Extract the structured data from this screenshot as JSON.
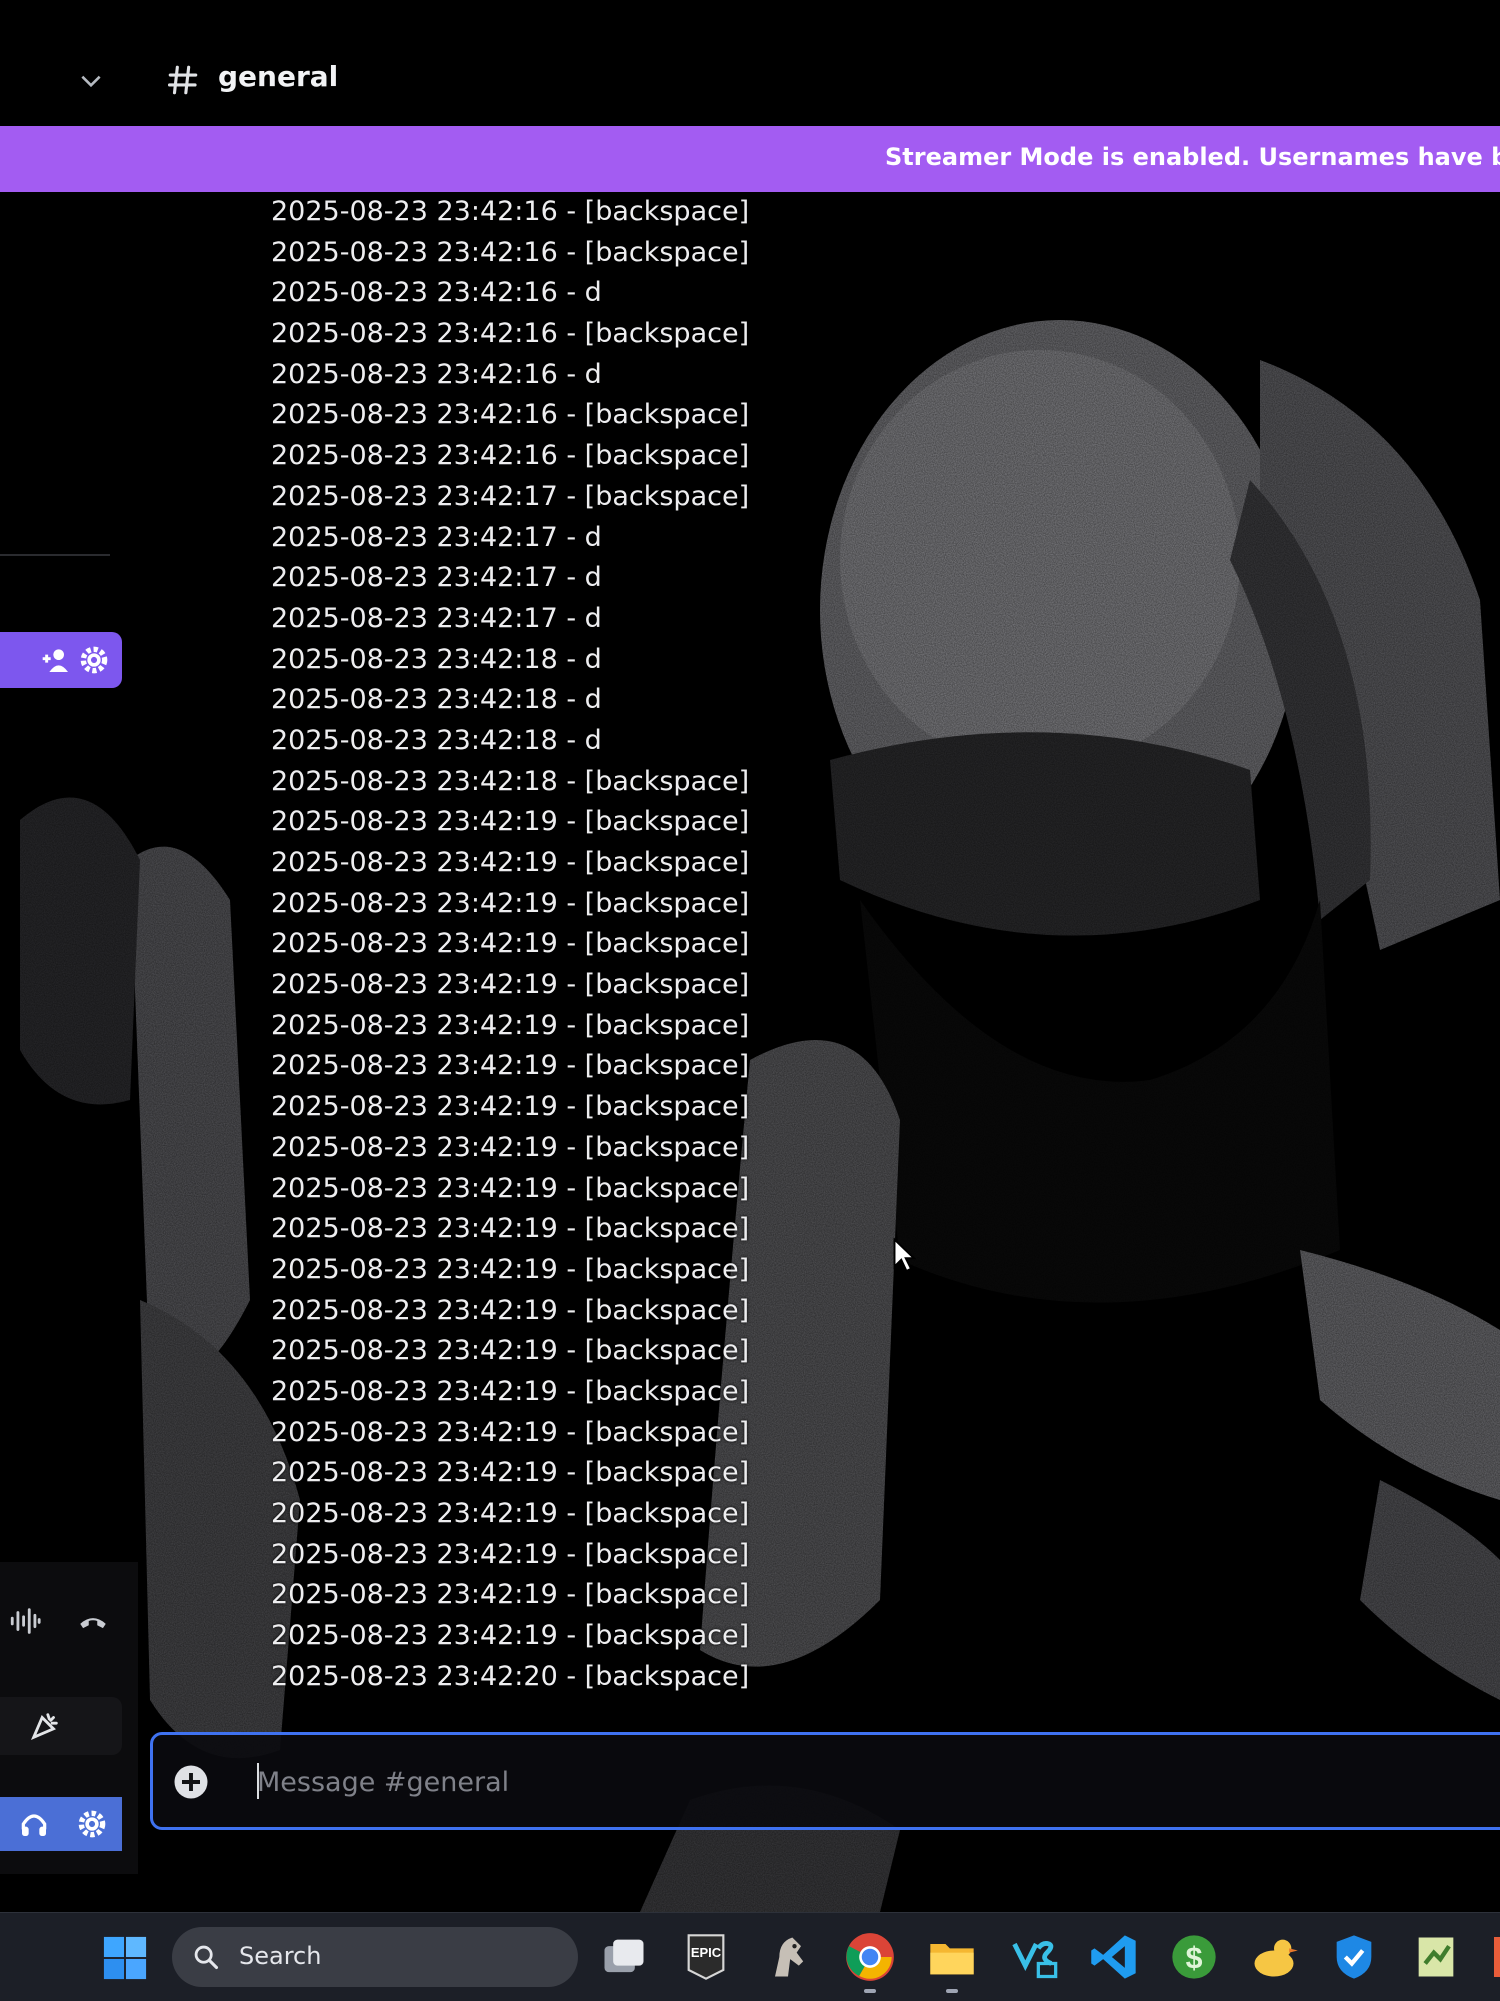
{
  "header": {
    "channel_name": "general"
  },
  "banner": {
    "text": "Streamer Mode is enabled. Usernames have been trunc"
  },
  "messages": [
    "2025-08-23 23:42:16 - [backspace]",
    "2025-08-23 23:42:16 - [backspace]",
    "2025-08-23 23:42:16 - d",
    "2025-08-23 23:42:16 - [backspace]",
    "2025-08-23 23:42:16 - d",
    "2025-08-23 23:42:16 - [backspace]",
    "2025-08-23 23:42:16 - [backspace]",
    "2025-08-23 23:42:17 - [backspace]",
    "2025-08-23 23:42:17 - d",
    "2025-08-23 23:42:17 - d",
    "2025-08-23 23:42:17 - d",
    "2025-08-23 23:42:18 - d",
    "2025-08-23 23:42:18 - d",
    "2025-08-23 23:42:18 - d",
    "2025-08-23 23:42:18 - [backspace]",
    "2025-08-23 23:42:19 - [backspace]",
    "2025-08-23 23:42:19 - [backspace]",
    "2025-08-23 23:42:19 - [backspace]",
    "2025-08-23 23:42:19 - [backspace]",
    "2025-08-23 23:42:19 - [backspace]",
    "2025-08-23 23:42:19 - [backspace]",
    "2025-08-23 23:42:19 - [backspace]",
    "2025-08-23 23:42:19 - [backspace]",
    "2025-08-23 23:42:19 - [backspace]",
    "2025-08-23 23:42:19 - [backspace]",
    "2025-08-23 23:42:19 - [backspace]",
    "2025-08-23 23:42:19 - [backspace]",
    "2025-08-23 23:42:19 - [backspace]",
    "2025-08-23 23:42:19 - [backspace]",
    "2025-08-23 23:42:19 - [backspace]",
    "2025-08-23 23:42:19 - [backspace]",
    "2025-08-23 23:42:19 - [backspace]",
    "2025-08-23 23:42:19 - [backspace]",
    "2025-08-23 23:42:19 - [backspace]",
    "2025-08-23 23:42:19 - [backspace]",
    "2025-08-23 23:42:19 - [backspace]",
    "2025-08-23 23:42:20 - [backspace]"
  ],
  "composer": {
    "placeholder": "Message #general"
  },
  "taskbar": {
    "search_label": "Search",
    "apps": [
      "task-view",
      "epic-games",
      "horse-game",
      "chrome",
      "file-explorer",
      "visual-studio",
      "vscode",
      "money-app",
      "duck-app",
      "shield-app",
      "notepad-app"
    ]
  },
  "colors": {
    "banner": "#a35cf2",
    "voice_pill": "#7d57ee",
    "account_pill": "#4b6fd6",
    "composer_border": "#3f72f0"
  }
}
